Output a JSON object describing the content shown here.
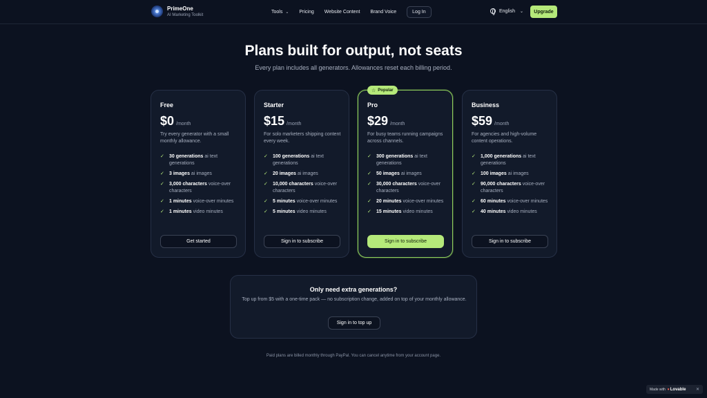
{
  "brand": {
    "name": "PrimeOne",
    "subtitle": "AI Marketing Toolkit"
  },
  "nav": {
    "tools": "Tools",
    "pricing": "Pricing",
    "website_content": "Website Content",
    "brand_voice": "Brand Voice",
    "login": "Log In",
    "language": "English",
    "upgrade": "Upgrade"
  },
  "hero": {
    "title": "Plans built for output, not seats",
    "subtitle": "Every plan includes all generators. Allowances reset each billing period."
  },
  "period_label": "/month",
  "popular_label": "Popular",
  "plans": [
    {
      "name": "Free",
      "price": "$0",
      "description": "Try every generator with a small monthly allowance.",
      "features": [
        {
          "value": "30 generations",
          "label": "ai text generations"
        },
        {
          "value": "3 images",
          "label": "ai images"
        },
        {
          "value": "3,000 characters",
          "label": "voice-over characters"
        },
        {
          "value": "1 minutes",
          "label": "voice-over minutes"
        },
        {
          "value": "1 minutes",
          "label": "video minutes"
        }
      ],
      "button": "Get started"
    },
    {
      "name": "Starter",
      "price": "$15",
      "description": "For solo marketers shipping content every week.",
      "features": [
        {
          "value": "100 generations",
          "label": "ai text generations"
        },
        {
          "value": "20 images",
          "label": "ai images"
        },
        {
          "value": "10,000 characters",
          "label": "voice-over characters"
        },
        {
          "value": "5 minutes",
          "label": "voice-over minutes"
        },
        {
          "value": "5 minutes",
          "label": "video minutes"
        }
      ],
      "button": "Sign in to subscribe"
    },
    {
      "name": "Pro",
      "price": "$29",
      "description": "For busy teams running campaigns across channels.",
      "features": [
        {
          "value": "300 generations",
          "label": "ai text generations"
        },
        {
          "value": "50 images",
          "label": "ai images"
        },
        {
          "value": "30,000 characters",
          "label": "voice-over characters"
        },
        {
          "value": "20 minutes",
          "label": "voice-over minutes"
        },
        {
          "value": "15 minutes",
          "label": "video minutes"
        }
      ],
      "button": "Sign in to subscribe"
    },
    {
      "name": "Business",
      "price": "$59",
      "description": "For agencies and high-volume content operations.",
      "features": [
        {
          "value": "1,000 generations",
          "label": "ai text generations"
        },
        {
          "value": "100 images",
          "label": "ai images"
        },
        {
          "value": "90,000 characters",
          "label": "voice-over characters"
        },
        {
          "value": "60 minutes",
          "label": "voice-over minutes"
        },
        {
          "value": "40 minutes",
          "label": "video minutes"
        }
      ],
      "button": "Sign in to subscribe"
    }
  ],
  "topup": {
    "title": "Only need extra generations?",
    "description": "Top up from $5 with a one-time pack — no subscription change, added on top of your monthly allowance.",
    "button": "Sign in to top up"
  },
  "footnote": "Paid plans are billed monthly through PayPal. You can cancel anytime from your account page.",
  "badge": {
    "made_with": "Made with",
    "lovable": "Lovable"
  },
  "colors": {
    "accent": "#b5e97a",
    "background": "#0c1220",
    "card": "#121a2a"
  }
}
